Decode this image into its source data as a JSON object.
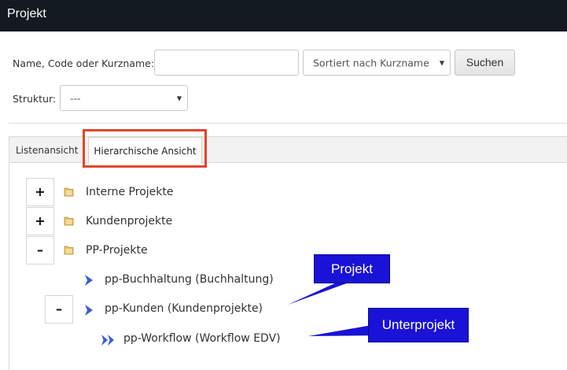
{
  "header": {
    "title": "Projekt"
  },
  "search": {
    "label": "Name, Code oder Kurzname:",
    "input_value": "",
    "sort_value": "Sortiert nach Kurzname",
    "button": "Suchen"
  },
  "structure": {
    "label": "Struktur:",
    "value": "---"
  },
  "tabs": [
    {
      "label": "Listenansicht",
      "active": false
    },
    {
      "label": "Hierarchische Ansicht",
      "active": true
    }
  ],
  "tree": {
    "nodes": [
      {
        "toggle": "+",
        "label": "Interne Projekte"
      },
      {
        "toggle": "+",
        "label": "Kundenprojekte"
      },
      {
        "toggle": "–",
        "label": "PP-Projekte"
      }
    ],
    "children": [
      {
        "label": "pp-Buchhaltung (Buchhaltung)"
      },
      {
        "toggle": "–",
        "label": "pp-Kunden (Kundenprojekte)"
      }
    ],
    "grandchildren": [
      {
        "label": "pp-Workflow (Workflow EDV)"
      }
    ]
  },
  "callouts": {
    "project": "Projekt",
    "subproject": "Unterprojekt"
  },
  "colors": {
    "header_bg": "#141a22",
    "highlight": "#e0462a",
    "callout_bg": "#1a12d6",
    "chevron": "#3a5bd9"
  }
}
